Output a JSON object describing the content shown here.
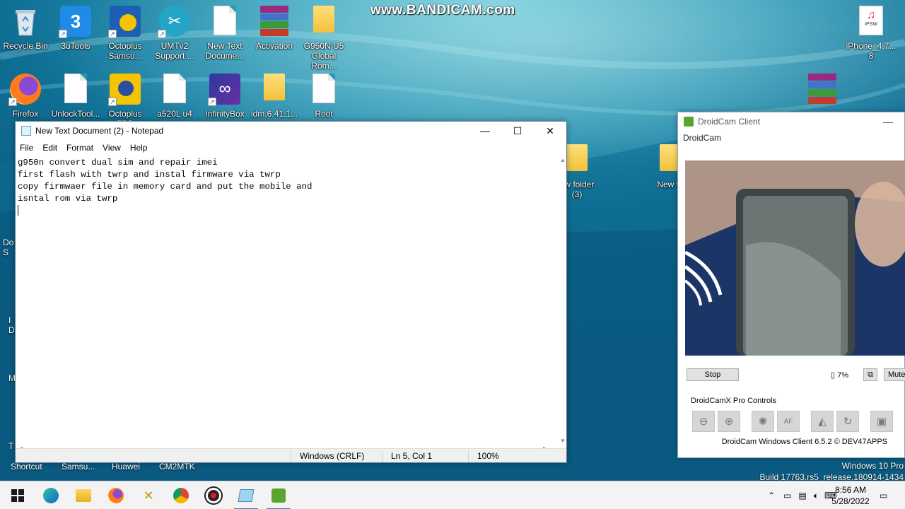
{
  "watermark": "www.BANDICAM.com",
  "desktop": {
    "icons_row1": [
      {
        "label": "Recycle Bin",
        "icon": "recycle-bin-icon"
      },
      {
        "label": "3uTools",
        "icon": "3utools-icon"
      },
      {
        "label": "Octoplus\nSamsu...",
        "icon": "octoplus-samsung-icon"
      },
      {
        "label": "UMTv2\nSupport ...",
        "icon": "umtv2-icon"
      },
      {
        "label": "New Text\nDocume...",
        "icon": "text-document-icon"
      },
      {
        "label": "Activation",
        "icon": "winrar-archive-icon"
      },
      {
        "label": "G950N U5\nGlobal Rom...",
        "icon": "folder-icon"
      }
    ],
    "icons_row2": [
      {
        "label": "Firefox",
        "icon": "firefox-icon"
      },
      {
        "label": "UnlockTool...",
        "icon": "text-document-icon"
      },
      {
        "label": "Octoplus FRP",
        "icon": "octoplus-frp-icon"
      },
      {
        "label": "a520L u4",
        "icon": "text-document-icon"
      },
      {
        "label": "InfinityBox",
        "icon": "infinitybox-icon"
      },
      {
        "label": "idm.6.41.1...",
        "icon": "folder-icon"
      },
      {
        "label": "Root",
        "icon": "text-document-icon"
      }
    ],
    "icon_right_top": {
      "label": "iPhone_4.7...\n8",
      "badge": "IPSW"
    },
    "behind_folders": [
      "ew folder\n(3)",
      "New fo"
    ],
    "left_edge_fragments": [
      "Do\nS",
      "I\nD",
      "M",
      "T"
    ],
    "bottom_labels": [
      "Shortcut",
      "Samsu...",
      "Huawei",
      "CM2MTK"
    ],
    "windows_watermark": {
      "line1": "Windows 10 Pro",
      "line2": "Build 17763.rs5_release.180914-1434"
    }
  },
  "notepad": {
    "title": "New Text Document (2) - Notepad",
    "menu": [
      "File",
      "Edit",
      "Format",
      "View",
      "Help"
    ],
    "lines": [
      "g950n convert dual sim and repair imei",
      "first flash with twrp and instal firmware via twrp",
      "copy firmwaer file in memory card and put the mobile and",
      "isntal rom via twrp"
    ],
    "status": {
      "encoding": "Windows (CRLF)",
      "position": "Ln 5, Col 1",
      "zoom": "100%"
    },
    "controls": {
      "minimize": "—",
      "maximize": "☐",
      "close": "✕"
    }
  },
  "droidcam": {
    "title": "DroidCam Client",
    "subtitle": "DroidCam",
    "stop_label": "Stop",
    "battery": "7%",
    "mute_label": "Mute",
    "pro_controls_label": "DroidCamX Pro Controls",
    "footer": "DroidCam Windows Client 6.5.2 © DEV47APPS",
    "pro_buttons": [
      "zoom-out-icon",
      "zoom-in-icon",
      "brightness-icon",
      "autofocus-icon",
      "mirror-icon",
      "rotate-icon",
      "jpg-icon"
    ],
    "af_label": "AF"
  },
  "taskbar": {
    "time": "8:56 AM",
    "date": "5/28/2022",
    "apps": [
      "start-icon",
      "edge-icon",
      "file-explorer-icon",
      "firefox-icon",
      "xmind-icon",
      "chrome-like-icon",
      "record-icon",
      "notepad-icon",
      "droidcam-icon"
    ]
  }
}
